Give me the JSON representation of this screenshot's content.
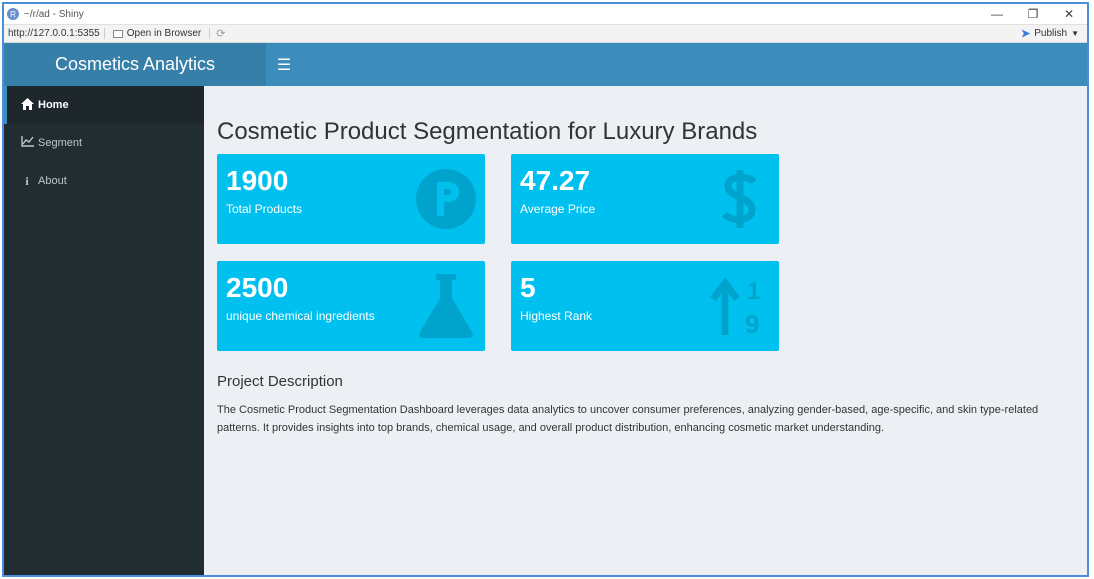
{
  "window": {
    "title": "~/r/ad - Shiny",
    "app_icon": "R"
  },
  "addressbar": {
    "url": "http://127.0.0.1:5355",
    "open_label": "Open in Browser",
    "publish_label": "Publish"
  },
  "header": {
    "app_title": "Cosmetics Analytics",
    "menu_icon": "hamburger-icon"
  },
  "sidebar": {
    "items": [
      {
        "label": "Home",
        "icon": "home-icon",
        "active": true
      },
      {
        "label": "Segment",
        "icon": "line-chart-icon",
        "active": false
      },
      {
        "label": "About",
        "icon": "info-icon",
        "active": false
      }
    ]
  },
  "main": {
    "title": "Cosmetic Product Segmentation for Luxury Brands",
    "boxes": [
      {
        "value": "1900",
        "label": "Total Products",
        "icon": "parking-circle-icon"
      },
      {
        "value": "47.27",
        "label": "Average Price",
        "icon": "dollar-icon"
      },
      {
        "value": "2500",
        "label": "unique chemical ingredients",
        "icon": "flask-icon"
      },
      {
        "value": "5",
        "label": "Highest Rank",
        "icon": "sort-numeric-up-icon"
      }
    ],
    "description_title": "Project Description",
    "description": "The Cosmetic Product Segmentation Dashboard leverages data analytics to uncover consumer preferences, analyzing gender-based, age-specific, and skin type-related patterns. It provides insights into top brands, chemical usage, and overall product distribution, enhancing cosmetic market understanding."
  },
  "colors": {
    "header": "#3c8dbc",
    "logo": "#367fa9",
    "sidebar": "#222d32",
    "box": "#00c0ef",
    "content_bg": "#ecf0f5"
  }
}
